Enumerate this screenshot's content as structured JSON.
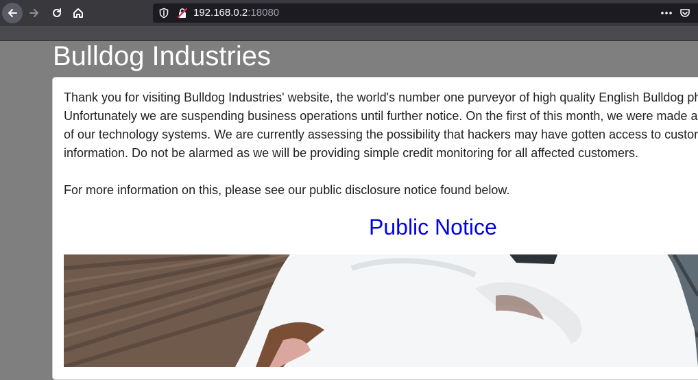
{
  "browser": {
    "url_host": "192.168.0.2",
    "url_port": ":18080"
  },
  "page": {
    "title": "Bulldog Industries",
    "paragraph1_lines": [
      "Thank you for visiting Bulldog Industries' website, the world's number one purveyor of high quality English Bulldog ph",
      "Unfortunately we are suspending business operations until further notice. On the first of this month, we were made a",
      "of our technology systems. We are currently assessing the possibility that hackers may have gotten access to custor",
      "information. Do not be alarmed as we will be providing simple credit monitoring for all affected customers."
    ],
    "paragraph2": "For more information on this, please see our public disclosure notice found below.",
    "notice_link": "Public Notice"
  },
  "icons": {
    "back": "back-arrow-icon",
    "forward": "forward-arrow-icon",
    "reload": "reload-icon",
    "home": "home-icon",
    "tracking": "tracking-shield-icon",
    "insecure": "insecure-lock-icon",
    "more": "more-actions-icon",
    "pocket": "pocket-icon"
  },
  "colors": {
    "page_bg": "#7f7f7f",
    "link": "#0000ee",
    "toolbar": "#38383d"
  }
}
